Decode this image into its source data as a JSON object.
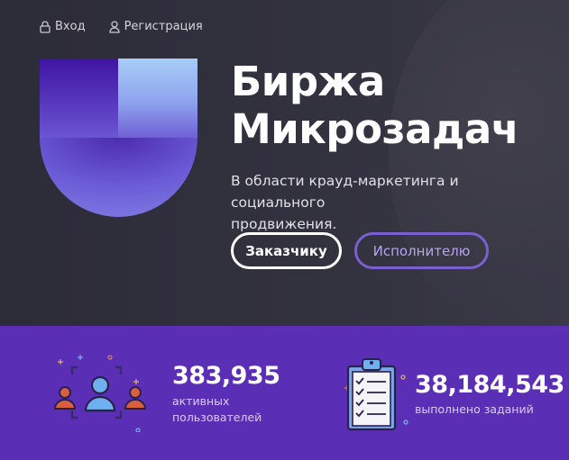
{
  "nav": {
    "login_label": "Вход",
    "register_label": "Регистрация"
  },
  "hero": {
    "title_line1": "Биржа",
    "title_line2": "Микрозадач",
    "subtitle_line1": "В области крауд-маркетинга и социального",
    "subtitle_line2": "продвижения.",
    "customer_button": "Заказчику",
    "executor_button": "Исполнителю"
  },
  "stats": {
    "users": {
      "value": "383,935",
      "label_line1": "активных",
      "label_line2": "пользователей",
      "icon": "users-icon"
    },
    "tasks": {
      "value": "38,184,543",
      "label": "выполнено заданий",
      "icon": "clipboard-checklist-icon"
    }
  },
  "colors": {
    "hero_bg": "#2e2d3b",
    "stats_bg": "#5a2fb5",
    "accent": "#7a5fd0",
    "logo_dark": "#4a1aa8",
    "logo_light": "#9ec3f5"
  }
}
